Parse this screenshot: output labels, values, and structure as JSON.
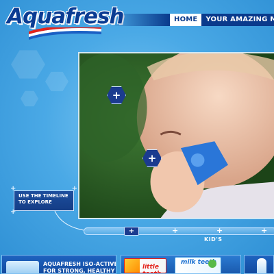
{
  "brand": {
    "name": "Aquafresh",
    "stripe_colors": [
      "#e3231b",
      "#ffffff",
      "#1a5fc4"
    ]
  },
  "nav": {
    "items": [
      {
        "label": "HOME",
        "active": true
      },
      {
        "label": "YOUR AMAZING MOUTH",
        "active": false
      }
    ]
  },
  "video": {
    "hotspots": [
      {
        "icon": "plus-icon",
        "symbol": "+"
      },
      {
        "icon": "plus-icon",
        "symbol": "+"
      }
    ]
  },
  "tooltip": {
    "text": "USE THE TIMELINE TO EXPLORE"
  },
  "timeline": {
    "handle_symbol": "+",
    "marker_symbol": "+",
    "section_label": "KID'S"
  },
  "bottom": {
    "promo_text_line1": "AQUAFRESH ISO-ACTIVE",
    "promo_text_line2": "FOR STRONG, HEALTHY",
    "pack_a_label": "little teeth",
    "pack_b_label": "milk teeth"
  },
  "colors": {
    "accent": "#0a3a8c",
    "background": "#4aa9e6",
    "hotspot": "#1b3b8f"
  }
}
